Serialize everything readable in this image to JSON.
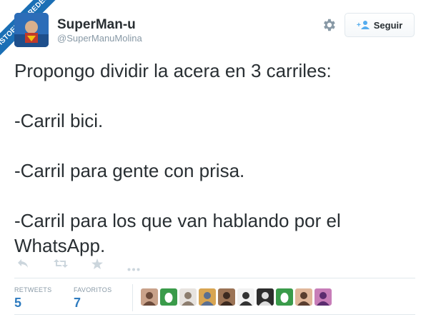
{
  "watermark": "VISTOENLASREDES",
  "user": {
    "name": "SuperMan-u",
    "handle": "@SuperManuMolina"
  },
  "follow_button": {
    "label": "Seguir"
  },
  "tweet": {
    "lines": [
      "Propongo dividir la acera en 3 carriles:",
      "-Carril bici.",
      "-Carril para gente con prisa.",
      "-Carril para los que van hablando por el WhatsApp."
    ]
  },
  "actions": [
    {
      "name": "reply-icon"
    },
    {
      "name": "retweet-icon"
    },
    {
      "name": "favorite-star-icon"
    },
    {
      "name": "more-options-icon"
    }
  ],
  "stats": {
    "retweets_label": "RETWEETS",
    "retweets_value": "5",
    "favorites_label": "FAVORITOS",
    "favorites_value": "7"
  },
  "colors": {
    "accent": "#2e7bbf",
    "text": "#292f33",
    "muted": "#8899a6",
    "border": "#e1e8ed",
    "egg_green": "#3a9b4a"
  },
  "favoriters": [
    {
      "type": "photo",
      "bg": "#c9a28a",
      "fg": "#6b4a3a"
    },
    {
      "type": "egg",
      "bg": "#3a9b4a"
    },
    {
      "type": "photo",
      "bg": "#e7e3df",
      "fg": "#8c7d6e"
    },
    {
      "type": "photo",
      "bg": "#d8a552",
      "fg": "#5a6f91"
    },
    {
      "type": "photo",
      "bg": "#9b7355",
      "fg": "#3c2a20"
    },
    {
      "type": "photo",
      "bg": "#f1f1f1",
      "fg": "#333333"
    },
    {
      "type": "photo",
      "bg": "#2c2c2c",
      "fg": "#dddddd"
    },
    {
      "type": "egg",
      "bg": "#3a9b4a"
    },
    {
      "type": "photo",
      "bg": "#e0b79a",
      "fg": "#5a3e2f"
    },
    {
      "type": "photo",
      "bg": "#c77db8",
      "fg": "#5b2c6e"
    }
  ]
}
